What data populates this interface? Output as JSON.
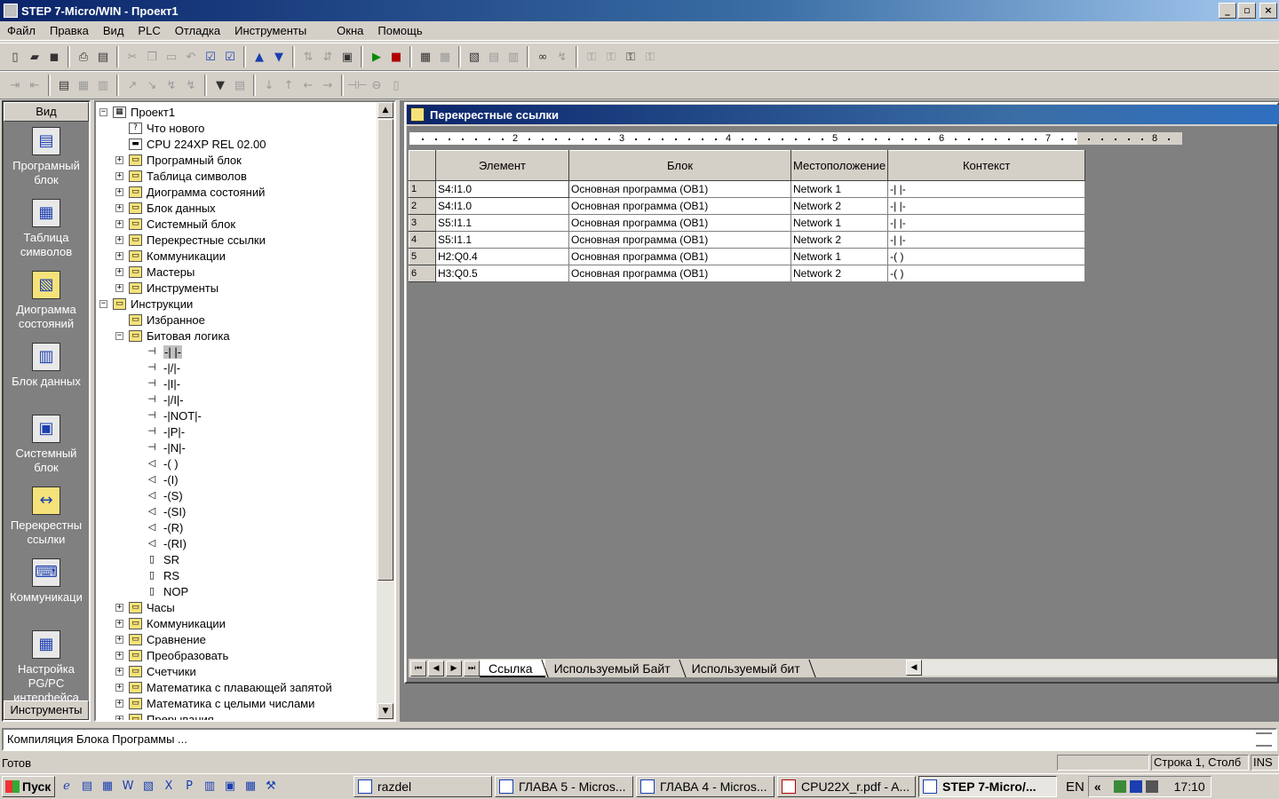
{
  "window": {
    "title": "STEP 7-Micro/WIN - Проект1",
    "buttons": [
      "_",
      "▫",
      "×"
    ]
  },
  "menu": [
    "Файл",
    "Правка",
    "Вид",
    "PLC",
    "Отладка",
    "Инструменты",
    "Окна",
    "Помощь"
  ],
  "nav": {
    "header": "Вид",
    "footer": "Инструменты",
    "items": [
      {
        "label": "Програмный блок",
        "icon": "program-block-icon"
      },
      {
        "label": "Таблица символов",
        "icon": "symbol-table-icon"
      },
      {
        "label": "Диограмма состояний",
        "icon": "status-chart-icon"
      },
      {
        "label": "Блок данных",
        "icon": "data-block-icon"
      },
      {
        "label": "Системный блок",
        "icon": "system-block-icon"
      },
      {
        "label": "Перекрестны ссылки",
        "icon": "cross-reference-icon"
      },
      {
        "label": "Коммуникаци",
        "icon": "communication-icon"
      },
      {
        "label": "Настройка PG/PC интерфейса",
        "icon": "pg-pc-interface-icon"
      }
    ]
  },
  "tree": [
    {
      "label": "Проект1",
      "level": 0,
      "exp": "−",
      "icon": "project-icon"
    },
    {
      "label": "Что нового",
      "level": 1,
      "exp": "",
      "icon": "help-icon"
    },
    {
      "label": "CPU 224XP REL 02.00",
      "level": 1,
      "exp": "",
      "icon": "cpu-icon"
    },
    {
      "label": "Програмный блок",
      "level": 1,
      "exp": "+",
      "icon": "folder-icon"
    },
    {
      "label": "Таблица символов",
      "level": 1,
      "exp": "+",
      "icon": "folder-icon"
    },
    {
      "label": "Диограмма состояний",
      "level": 1,
      "exp": "+",
      "icon": "folder-icon"
    },
    {
      "label": "Блок данных",
      "level": 1,
      "exp": "+",
      "icon": "folder-icon"
    },
    {
      "label": "Системный блок",
      "level": 1,
      "exp": "+",
      "icon": "folder-icon"
    },
    {
      "label": "Перекрестные ссылки",
      "level": 1,
      "exp": "+",
      "icon": "folder-icon"
    },
    {
      "label": "Коммуникации",
      "level": 1,
      "exp": "+",
      "icon": "folder-icon"
    },
    {
      "label": "Мастеры",
      "level": 1,
      "exp": "+",
      "icon": "folder-icon"
    },
    {
      "label": "Инструменты",
      "level": 1,
      "exp": "+",
      "icon": "folder-icon"
    },
    {
      "label": "Инструкции",
      "level": 0,
      "exp": "−",
      "icon": "folder-icon"
    },
    {
      "label": "Избранное",
      "level": 1,
      "exp": "",
      "icon": "folder-icon"
    },
    {
      "label": "Битовая логика",
      "level": 1,
      "exp": "−",
      "icon": "folder-icon"
    },
    {
      "label": "-| |-",
      "level": 2,
      "exp": "",
      "icon": "contact-icon",
      "selected": true
    },
    {
      "label": "-|/|-",
      "level": 2,
      "exp": "",
      "icon": "contact-icon"
    },
    {
      "label": "-|I|-",
      "level": 2,
      "exp": "",
      "icon": "contact-icon"
    },
    {
      "label": "-|/I|-",
      "level": 2,
      "exp": "",
      "icon": "contact-icon"
    },
    {
      "label": "-|NOT|-",
      "level": 2,
      "exp": "",
      "icon": "contact-icon"
    },
    {
      "label": "-|P|-",
      "level": 2,
      "exp": "",
      "icon": "contact-icon"
    },
    {
      "label": "-|N|-",
      "level": 2,
      "exp": "",
      "icon": "contact-icon"
    },
    {
      "label": "-( )",
      "level": 2,
      "exp": "",
      "icon": "coil-icon"
    },
    {
      "label": "-(I)",
      "level": 2,
      "exp": "",
      "icon": "coil-icon"
    },
    {
      "label": "-(S)",
      "level": 2,
      "exp": "",
      "icon": "coil-icon"
    },
    {
      "label": "-(SI)",
      "level": 2,
      "exp": "",
      "icon": "coil-icon"
    },
    {
      "label": "-(R)",
      "level": 2,
      "exp": "",
      "icon": "coil-icon"
    },
    {
      "label": "-(RI)",
      "level": 2,
      "exp": "",
      "icon": "coil-icon"
    },
    {
      "label": "SR",
      "level": 2,
      "exp": "",
      "icon": "box-icon"
    },
    {
      "label": "RS",
      "level": 2,
      "exp": "",
      "icon": "box-icon"
    },
    {
      "label": "NOP",
      "level": 2,
      "exp": "",
      "icon": "box-icon"
    },
    {
      "label": "Часы",
      "level": 1,
      "exp": "+",
      "icon": "folder-icon"
    },
    {
      "label": "Коммуникации",
      "level": 1,
      "exp": "+",
      "icon": "folder-icon"
    },
    {
      "label": "Сравнение",
      "level": 1,
      "exp": "+",
      "icon": "folder-icon"
    },
    {
      "label": "Преобразовать",
      "level": 1,
      "exp": "+",
      "icon": "folder-icon"
    },
    {
      "label": "Счетчики",
      "level": 1,
      "exp": "+",
      "icon": "folder-icon"
    },
    {
      "label": "Математика с плавающей запятой",
      "level": 1,
      "exp": "+",
      "icon": "folder-icon"
    },
    {
      "label": "Математика с целыми числами",
      "level": 1,
      "exp": "+",
      "icon": "folder-icon"
    },
    {
      "label": "Прерывания",
      "level": 1,
      "exp": "+",
      "icon": "folder-icon"
    }
  ],
  "crossref": {
    "title": "Перекрестные ссылки",
    "ruler": [
      "2",
      "3",
      "4",
      "5",
      "6",
      "7",
      "8"
    ],
    "columns": [
      "Элемент",
      "Блок",
      "Местоположение",
      "Контекст"
    ],
    "rows": [
      {
        "n": "1",
        "element": "S4:I1.0",
        "block": "Основная программа (OB1)",
        "location": "Network 1",
        "context": "-| |-"
      },
      {
        "n": "2",
        "element": "S4:I1.0",
        "block": "Основная программа (OB1)",
        "location": "Network 2",
        "context": "-| |-"
      },
      {
        "n": "3",
        "element": "S5:I1.1",
        "block": "Основная программа (OB1)",
        "location": "Network 1",
        "context": "-| |-"
      },
      {
        "n": "4",
        "element": "S5:I1.1",
        "block": "Основная программа (OB1)",
        "location": "Network 2",
        "context": "-| |-"
      },
      {
        "n": "5",
        "element": "H2:Q0.4",
        "block": "Основная программа (OB1)",
        "location": "Network 1",
        "context": "-( )"
      },
      {
        "n": "6",
        "element": "H3:Q0.5",
        "block": "Основная программа (OB1)",
        "location": "Network 2",
        "context": "-( )"
      }
    ],
    "tabs": [
      "Ссылка",
      "Используемый Байт",
      "Используемый бит"
    ]
  },
  "output": {
    "text": "Компиляция Блока Программы ..."
  },
  "status": {
    "main": "Готов",
    "position": "Строка 1, Столб",
    "mode": "INS"
  },
  "taskbar": {
    "start": "Пуск",
    "tasks": [
      {
        "label": "razdel",
        "active": false
      },
      {
        "label": "ГЛАВА 5 - Micros...",
        "active": false
      },
      {
        "label": "ГЛАВА 4 - Micros...",
        "active": false
      },
      {
        "label": "CPU22X_r.pdf - A...",
        "active": false
      },
      {
        "label": "STEP 7-Micro/...",
        "active": true
      }
    ],
    "lang": "EN",
    "chevron": "«",
    "time": "17:10"
  },
  "colors": {
    "titlebar": "#0a246a",
    "face": "#d4d0c8",
    "workspace": "#808080",
    "folder": "#f6e27a"
  }
}
